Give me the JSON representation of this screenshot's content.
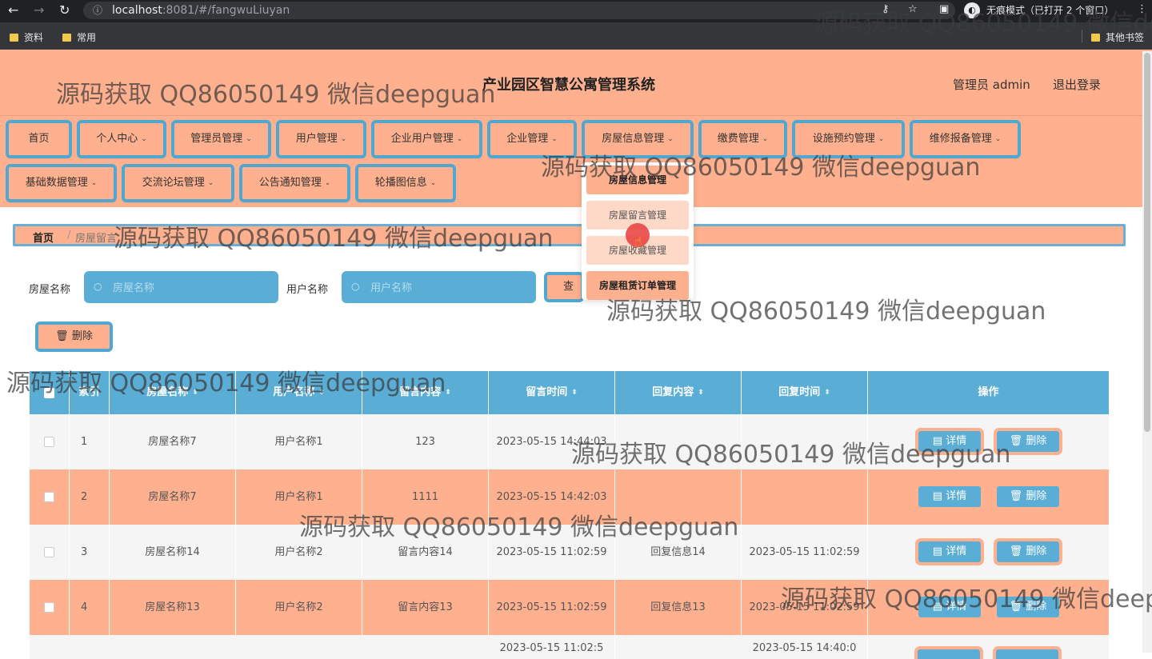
{
  "browser": {
    "url_host": "localhost",
    "url_rest": ":8081/#/fangwuLiuyan",
    "incognito_label": "无痕模式（已打开 2 个窗口）",
    "bookmarks": [
      "资料",
      "常用"
    ],
    "other_bookmarks": "其他书签"
  },
  "header": {
    "title": "产业园区智慧公寓管理系统",
    "admin": "管理员 admin",
    "logout": "退出登录"
  },
  "nav": {
    "row1": [
      "首页",
      "个人中心",
      "管理员管理",
      "用户管理",
      "企业用户管理",
      "企业管理",
      "房屋信息管理",
      "缴费管理",
      "设施预约管理",
      "维修报备管理"
    ],
    "row2": [
      "基础数据管理",
      "交流论坛管理",
      "公告通知管理",
      "轮播图信息"
    ],
    "dropdown": [
      "房屋信息管理",
      "房屋留言管理",
      "房屋收藏管理",
      "房屋租赁订单管理"
    ]
  },
  "breadcrumb": {
    "home": "首页",
    "current": "房屋留言"
  },
  "search": {
    "house_label": "房屋名称",
    "house_placeholder": "房屋名称",
    "user_label": "用户名称",
    "user_placeholder": "用户名称",
    "query": "查询",
    "delete": "删除"
  },
  "table": {
    "columns": [
      "索引",
      "房屋名称",
      "用户名称",
      "留言内容",
      "留言时间",
      "回复内容",
      "回复时间",
      "操作"
    ],
    "detail_label": "详情",
    "delete_label": "删除",
    "rows": [
      {
        "index": "1",
        "house": "房屋名称7",
        "user": "用户名称1",
        "content": "123",
        "time": "2023-05-15 14:44:03",
        "reply": "",
        "reply_time": ""
      },
      {
        "index": "2",
        "house": "房屋名称7",
        "user": "用户名称1",
        "content": "1111",
        "time": "2023-05-15 14:42:03",
        "reply": "",
        "reply_time": ""
      },
      {
        "index": "3",
        "house": "房屋名称14",
        "user": "用户名称2",
        "content": "留言内容14",
        "time": "2023-05-15 11:02:59",
        "reply": "回复信息14",
        "reply_time": "2023-05-15 11:02:59"
      },
      {
        "index": "4",
        "house": "房屋名称13",
        "user": "用户名称2",
        "content": "留言内容13",
        "time": "2023-05-15 11:02:59",
        "reply": "回复信息13",
        "reply_time": "2023-05-15 11:02:59"
      }
    ]
  },
  "watermark": "源码获取 QQ86050149 微信deepguan",
  "watermark_partial": "源码获取 QQ86050149 微信de"
}
